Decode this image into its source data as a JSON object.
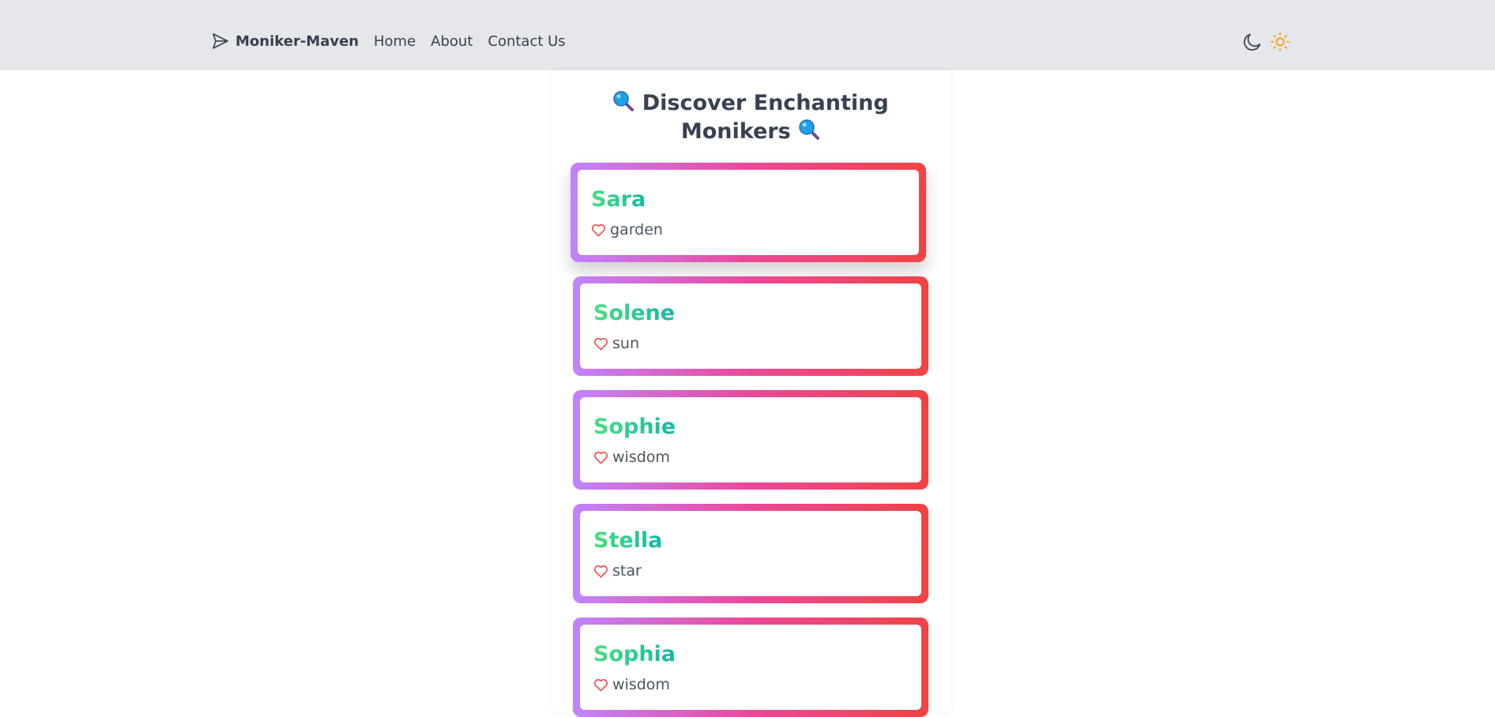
{
  "header": {
    "brand": "Moniker-Maven",
    "brand_icon": "paper-plane-icon",
    "nav": [
      "Home",
      "About",
      "Contact Us"
    ],
    "theme_icons": [
      "moon-icon",
      "sun-icon"
    ],
    "sun_color": "#f59e0b"
  },
  "main": {
    "heading_line1": "Discover Enchanting",
    "heading_line2": "Monikers",
    "heading_emoji": "magnifying-glass-icon",
    "cards": [
      {
        "name": "Sara",
        "meaning": "garden"
      },
      {
        "name": "Solene",
        "meaning": "sun"
      },
      {
        "name": "Sophie",
        "meaning": "wisdom"
      },
      {
        "name": "Stella",
        "meaning": "star"
      },
      {
        "name": "Sophia",
        "meaning": "wisdom"
      }
    ]
  },
  "colors": {
    "gradient": [
      "#c084fc",
      "#ec4899",
      "#ef4444"
    ],
    "name_gradient": [
      "#4ade80",
      "#14b8a6"
    ],
    "heart": "#ef4444",
    "topbar": "#e5e7eb"
  }
}
